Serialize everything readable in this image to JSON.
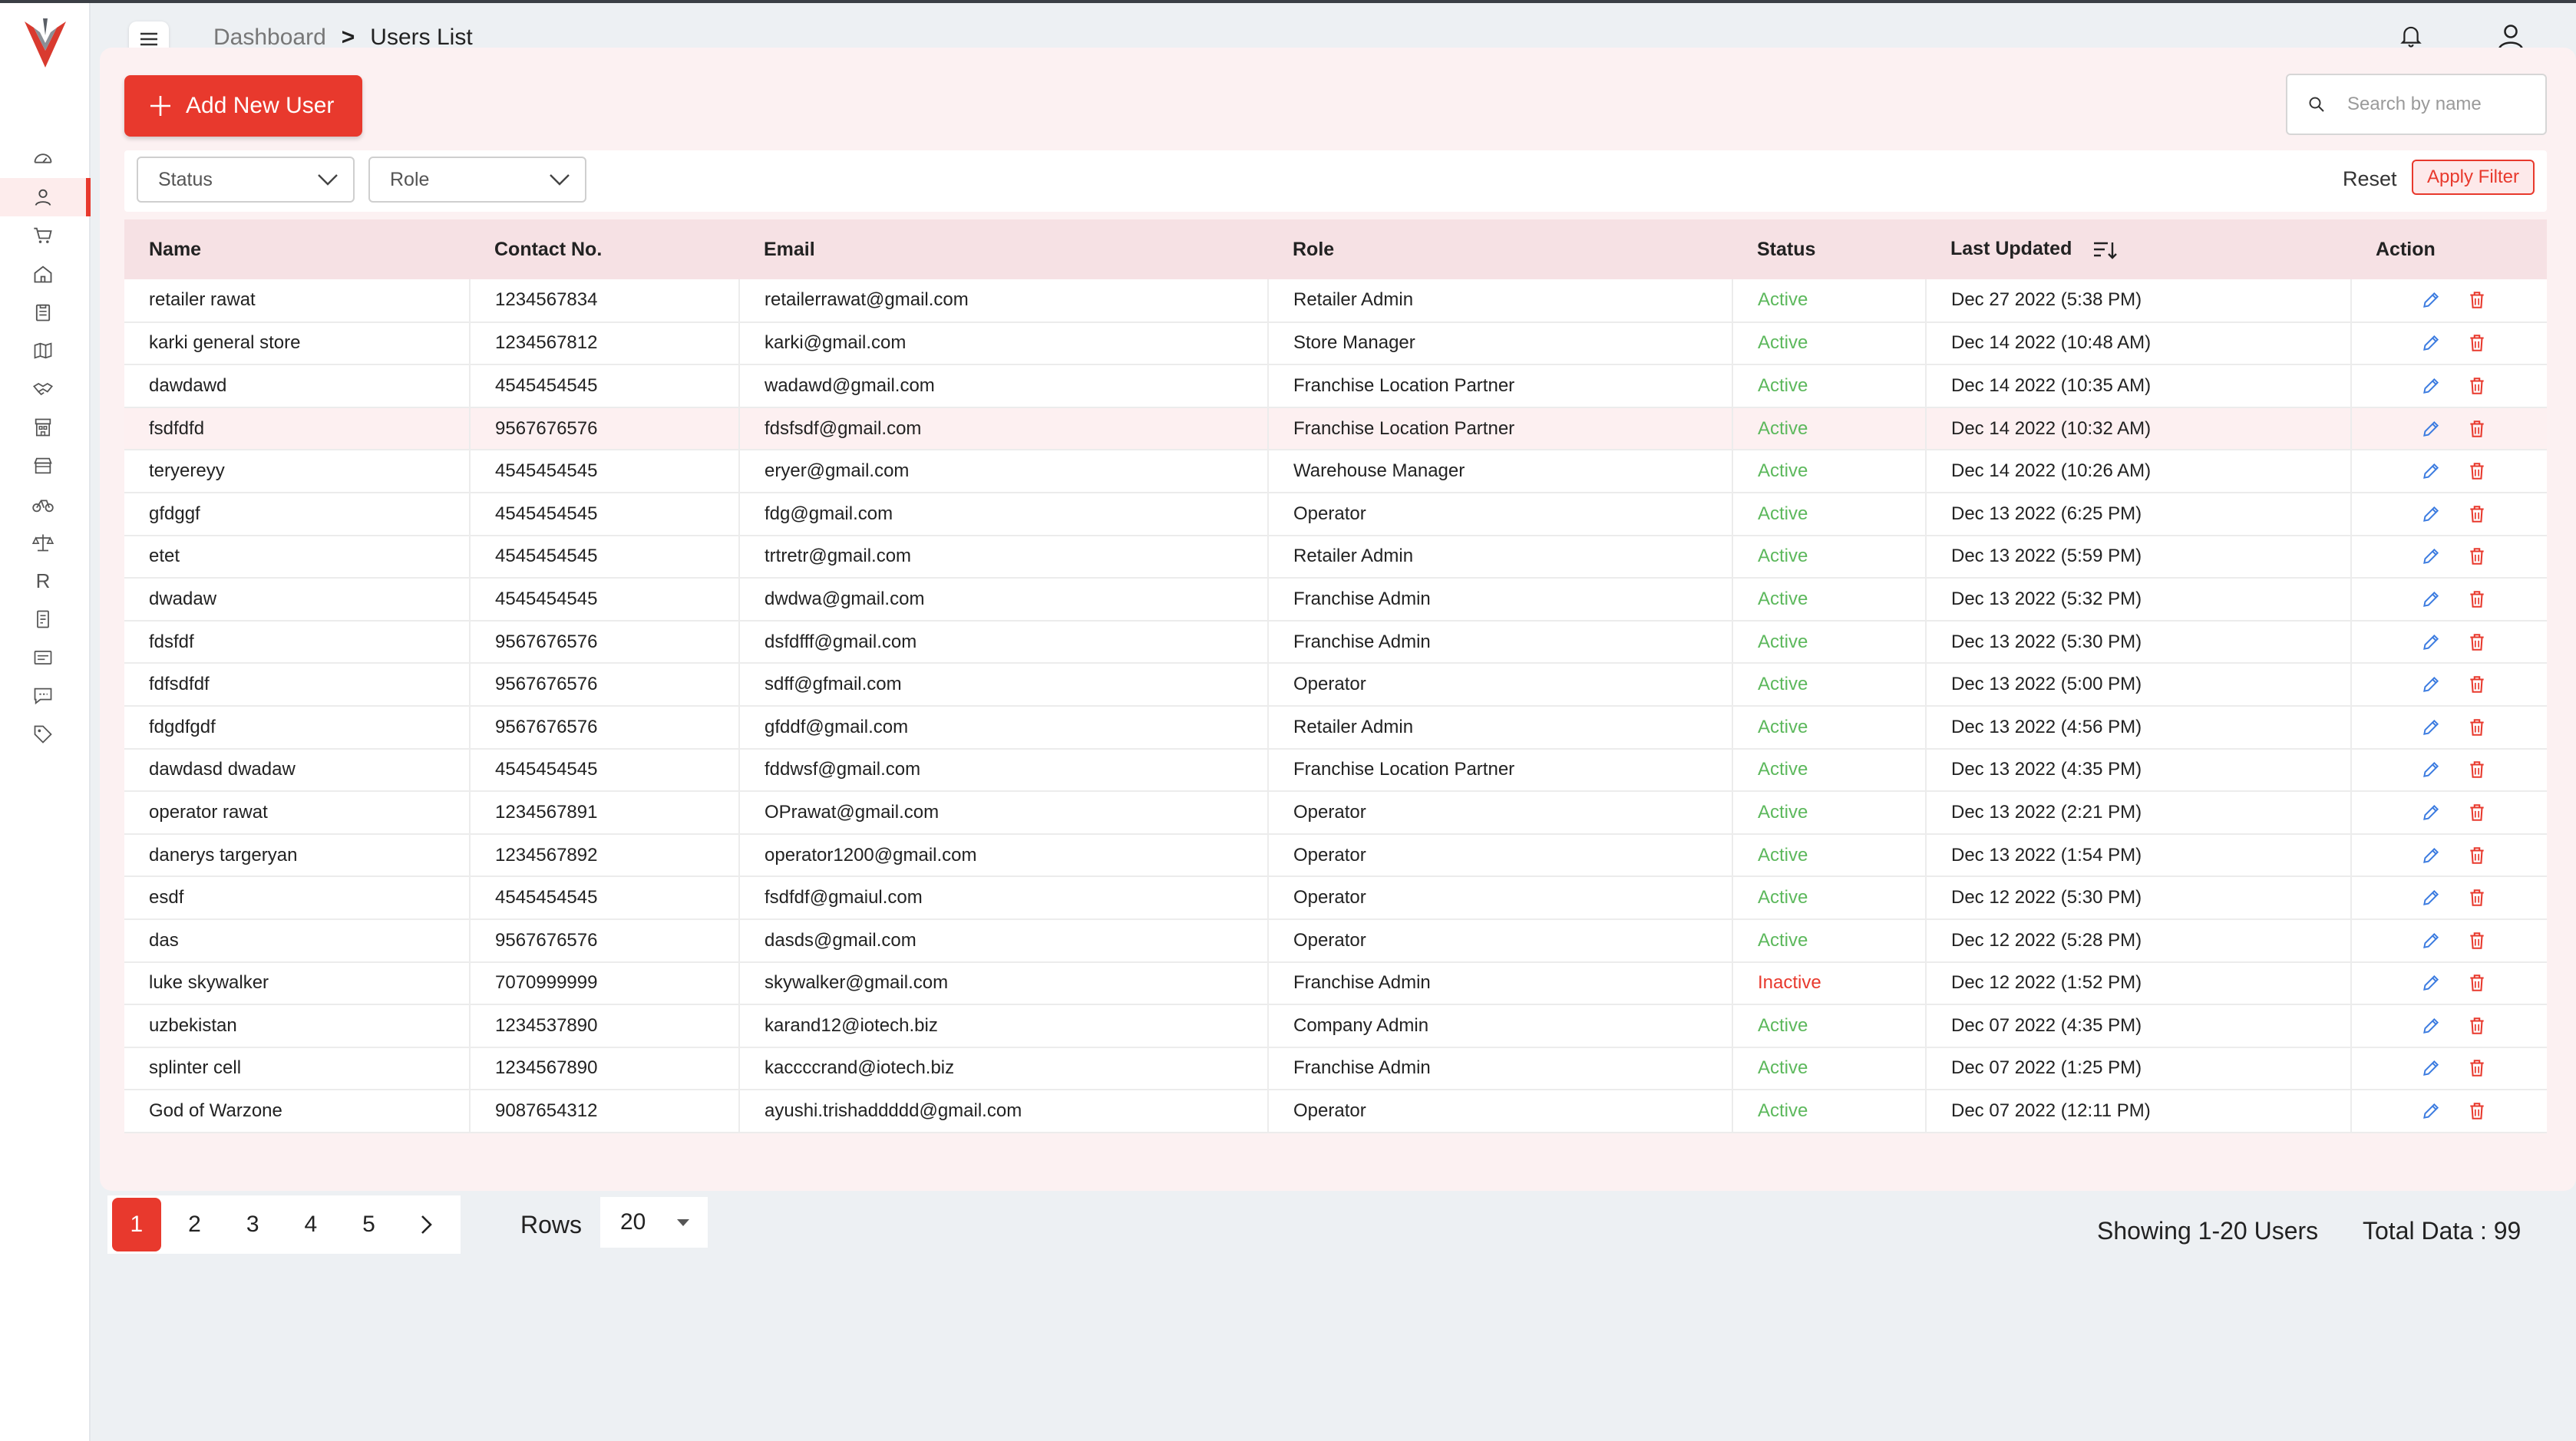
{
  "header": {
    "breadcrumb_root": "Dashboard",
    "breadcrumb_sep": ">",
    "breadcrumb_current": "Users List"
  },
  "toolbar": {
    "add_user_label": "Add New User",
    "search_placeholder": "Search by name"
  },
  "filters": {
    "status_label": "Status",
    "role_label": "Role",
    "reset_label": "Reset",
    "apply_label": "Apply Filter"
  },
  "table": {
    "columns": {
      "name": "Name",
      "contact": "Contact No.",
      "email": "Email",
      "role": "Role",
      "status": "Status",
      "updated": "Last Updated",
      "action": "Action"
    },
    "rows": [
      {
        "name": "retailer rawat",
        "contact": "1234567834",
        "email": "retailerrawat@gmail.com",
        "role": "Retailer Admin",
        "status": "Active",
        "updated": "Dec 27 2022 (5:38 PM)"
      },
      {
        "name": "karki general store",
        "contact": "1234567812",
        "email": "karki@gmail.com",
        "role": "Store Manager",
        "status": "Active",
        "updated": "Dec 14 2022 (10:48 AM)"
      },
      {
        "name": "dawdawd",
        "contact": "4545454545",
        "email": "wadawd@gmail.com",
        "role": "Franchise Location Partner",
        "status": "Active",
        "updated": "Dec 14 2022 (10:35 AM)"
      },
      {
        "name": "fsdfdfd",
        "contact": "9567676576",
        "email": "fdsfsdf@gmail.com",
        "role": "Franchise Location Partner",
        "status": "Active",
        "updated": "Dec 14 2022 (10:32 AM)"
      },
      {
        "name": "teryereyy",
        "contact": "4545454545",
        "email": "eryer@gmail.com",
        "role": "Warehouse Manager",
        "status": "Active",
        "updated": "Dec 14 2022 (10:26 AM)"
      },
      {
        "name": "gfdggf",
        "contact": "4545454545",
        "email": "fdg@gmail.com",
        "role": "Operator",
        "status": "Active",
        "updated": "Dec 13 2022 (6:25 PM)"
      },
      {
        "name": "etet",
        "contact": "4545454545",
        "email": "trtretr@gmail.com",
        "role": "Retailer Admin",
        "status": "Active",
        "updated": "Dec 13 2022 (5:59 PM)"
      },
      {
        "name": "dwadaw",
        "contact": "4545454545",
        "email": "dwdwa@gmail.com",
        "role": "Franchise Admin",
        "status": "Active",
        "updated": "Dec 13 2022 (5:32 PM)"
      },
      {
        "name": "fdsfdf",
        "contact": "9567676576",
        "email": "dsfdfff@gmail.com",
        "role": "Franchise Admin",
        "status": "Active",
        "updated": "Dec 13 2022 (5:30 PM)"
      },
      {
        "name": "fdfsdfdf",
        "contact": "9567676576",
        "email": "sdff@gfmail.com",
        "role": "Operator",
        "status": "Active",
        "updated": "Dec 13 2022 (5:00 PM)"
      },
      {
        "name": "fdgdfgdf",
        "contact": "9567676576",
        "email": "gfddf@gmail.com",
        "role": "Retailer Admin",
        "status": "Active",
        "updated": "Dec 13 2022 (4:56 PM)"
      },
      {
        "name": "dawdasd dwadaw",
        "contact": "4545454545",
        "email": "fddwsf@gmail.com",
        "role": "Franchise Location Partner",
        "status": "Active",
        "updated": "Dec 13 2022 (4:35 PM)"
      },
      {
        "name": "operator rawat",
        "contact": "1234567891",
        "email": "OPrawat@gmail.com",
        "role": "Operator",
        "status": "Active",
        "updated": "Dec 13 2022 (2:21 PM)"
      },
      {
        "name": "danerys targeryan",
        "contact": "1234567892",
        "email": "operator1200@gmail.com",
        "role": "Operator",
        "status": "Active",
        "updated": "Dec 13 2022 (1:54 PM)"
      },
      {
        "name": "esdf",
        "contact": "4545454545",
        "email": "fsdfdf@gmaiul.com",
        "role": "Operator",
        "status": "Active",
        "updated": "Dec 12 2022 (5:30 PM)"
      },
      {
        "name": "das",
        "contact": "9567676576",
        "email": "dasds@gmail.com",
        "role": "Operator",
        "status": "Active",
        "updated": "Dec 12 2022 (5:28 PM)"
      },
      {
        "name": "luke skywalker",
        "contact": "7070999999",
        "email": "skywalker@gmail.com",
        "role": "Franchise Admin",
        "status": "Inactive",
        "updated": "Dec 12 2022 (1:52 PM)"
      },
      {
        "name": "uzbekistan",
        "contact": "1234537890",
        "email": "karand12@iotech.biz",
        "role": "Company Admin",
        "status": "Active",
        "updated": "Dec 07 2022 (4:35 PM)"
      },
      {
        "name": "splinter cell",
        "contact": "1234567890",
        "email": "kaccccrand@iotech.biz",
        "role": "Franchise Admin",
        "status": "Active",
        "updated": "Dec 07 2022 (1:25 PM)"
      },
      {
        "name": "God of Warzone",
        "contact": "9087654312",
        "email": "ayushi.trishaddddd@gmail.com",
        "role": "Operator",
        "status": "Active",
        "updated": "Dec 07 2022 (12:11 PM)"
      }
    ]
  },
  "pagination": {
    "pages": [
      "1",
      "2",
      "3",
      "4",
      "5"
    ],
    "current": "1",
    "rows_label": "Rows",
    "rows_value": "20",
    "showing": "Showing 1-20 Users",
    "total": "Total Data : 99"
  },
  "colors": {
    "accent": "#e8392d",
    "active": "#5cb85c",
    "inactive": "#e8392d",
    "header_row": "#f6e1e4"
  },
  "sidebar": {
    "icons": [
      "dashboard-icon",
      "users-icon",
      "cart-icon",
      "home-icon",
      "clipboard-icon",
      "map-icon",
      "handshake-icon",
      "store-icon",
      "shop-icon",
      "bicycle-icon",
      "balance-scale-icon",
      "r-letter-icon",
      "receipt-icon",
      "message-icon",
      "chat-icon",
      "tag-icon"
    ],
    "letter": "R"
  }
}
